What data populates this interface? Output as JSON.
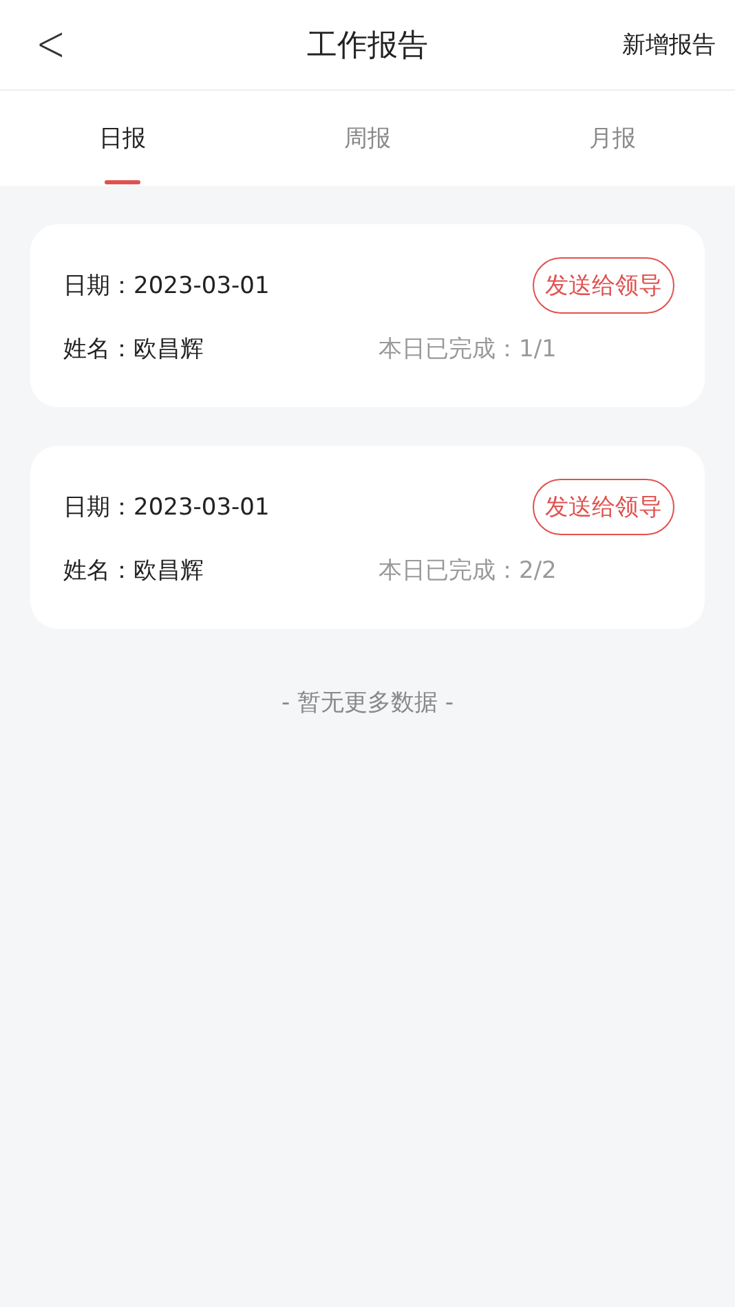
{
  "header": {
    "back": "<",
    "title": "工作报告",
    "action": "新增报告"
  },
  "tabs": [
    {
      "label": "日报",
      "selected": true
    },
    {
      "label": "周报",
      "selected": false
    },
    {
      "label": "月报",
      "selected": false
    }
  ],
  "reports": [
    {
      "date_label": "日期：",
      "date": "2023-03-01",
      "button": "发送给领导",
      "name_label": "姓名：",
      "name": "欧昌辉",
      "progress": "本日已完成：1/1"
    },
    {
      "date_label": "日期：",
      "date": "2023-03-01",
      "button": "发送给领导",
      "name_label": "姓名：",
      "name": "欧昌辉",
      "progress": "本日已完成：2/2"
    }
  ],
  "footer": "- 暂无更多数据 -"
}
